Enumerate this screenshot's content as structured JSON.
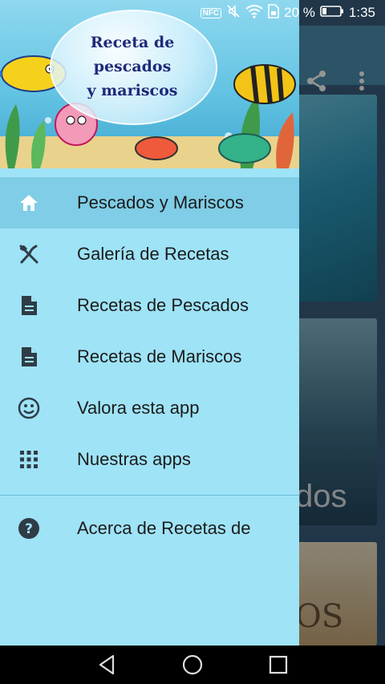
{
  "status_bar": {
    "nfc": "NFC",
    "battery_percent": "20 %",
    "time": "1:35",
    "icons": [
      "nfc-icon",
      "mute-icon",
      "wifi-icon",
      "sim-icon",
      "battery-icon"
    ]
  },
  "drawer": {
    "header_title_lines": [
      "Receta de",
      "pescados",
      "y mariscos"
    ],
    "menu": [
      {
        "label": "Pescados y Mariscos",
        "icon": "home-icon",
        "active": true
      },
      {
        "label": "Galería de Recetas",
        "icon": "utensils-icon",
        "active": false
      },
      {
        "label": "Recetas de Pescados",
        "icon": "document-icon",
        "active": false
      },
      {
        "label": "Recetas de Mariscos",
        "icon": "document-icon",
        "active": false
      },
      {
        "label": "Valora esta app",
        "icon": "smiley-icon",
        "active": false
      },
      {
        "label": "Nuestras apps",
        "icon": "grid-icon",
        "active": false
      }
    ],
    "secondary_menu": [
      {
        "label": "Acerca de Recetas de",
        "icon": "help-icon"
      }
    ]
  },
  "background": {
    "toolbar_icons": [
      "share-icon",
      "more-vert-icon"
    ],
    "card2_text": "dos",
    "card3_text": "OS"
  },
  "colors": {
    "drawer_bg": "#9fe3f7",
    "active_bg": "#7fcde6",
    "icon": "#2f3c46"
  },
  "nav_bar": {
    "icons": [
      "back-icon",
      "home-circle-icon",
      "recents-icon"
    ]
  }
}
